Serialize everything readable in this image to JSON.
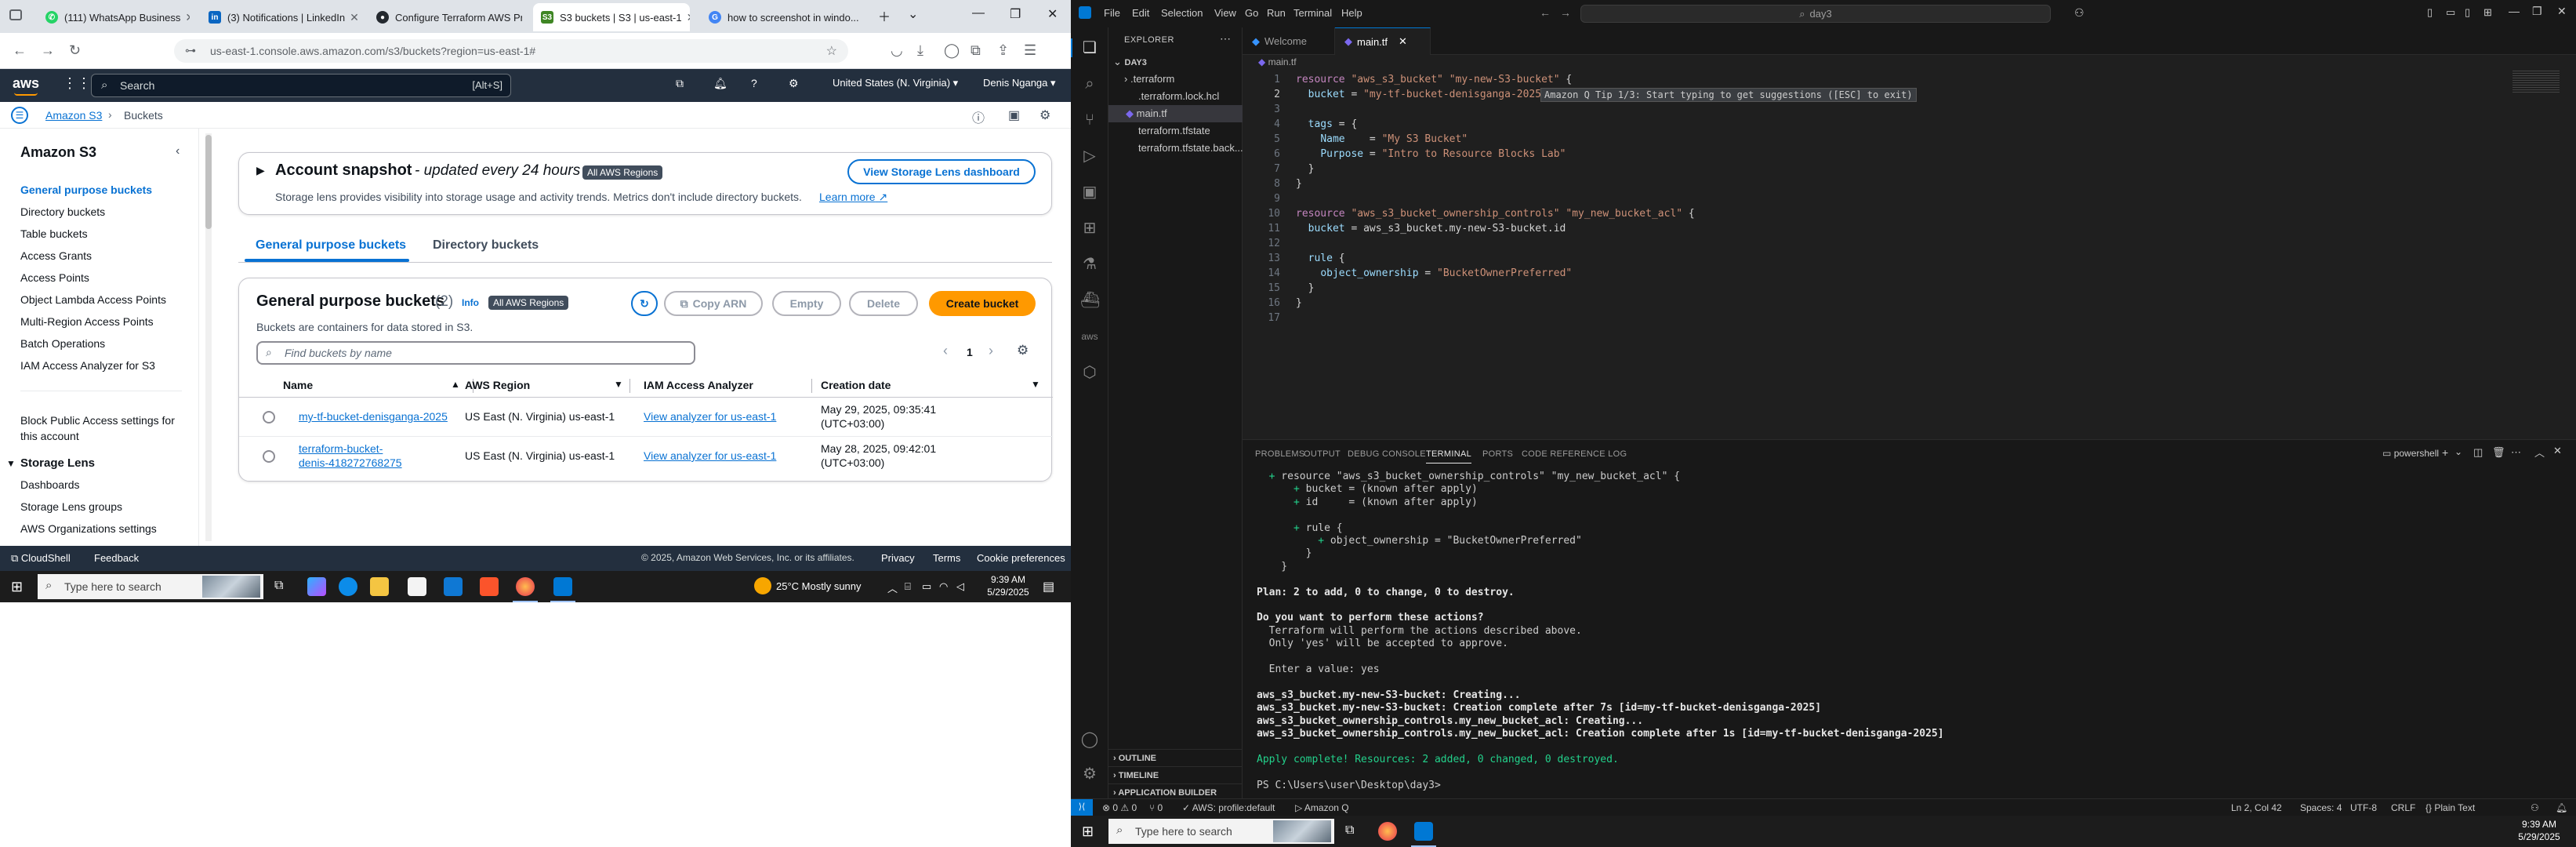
{
  "browser": {
    "tabs": [
      {
        "title": "(111) WhatsApp Business",
        "icon": "whatsapp-icon",
        "color": "#25d366"
      },
      {
        "title": "(3) Notifications | LinkedIn",
        "icon": "linkedin-icon",
        "color": "#0a66c2"
      },
      {
        "title": "Configure Terraform AWS Pr...",
        "icon": "github-icon",
        "color": "#24292f"
      },
      {
        "title": "S3 buckets | S3 | us-east-1",
        "icon": "aws-s3-icon",
        "color": "#3f8624"
      },
      {
        "title": "how to screenshot in windo...",
        "icon": "google-icon",
        "color": "#4285f4"
      }
    ],
    "url": "us-east-1.console.aws.amazon.com/s3/buckets?region=us-east-1#"
  },
  "aws": {
    "search_placeholder": "Search",
    "search_shortcut": "[Alt+S]",
    "region": "United States (N. Virginia)",
    "user": "Denis Nganga",
    "breadcrumb": [
      "Amazon S3",
      "Buckets"
    ],
    "sidenav": {
      "title": "Amazon S3",
      "items": [
        "General purpose buckets",
        "Directory buckets",
        "Table buckets",
        "Access Grants",
        "Access Points",
        "Object Lambda Access Points",
        "Multi-Region Access Points",
        "Batch Operations",
        "IAM Access Analyzer for S3"
      ],
      "block_public": "Block Public Access settings for this account",
      "storage_lens_title": "Storage Lens",
      "storage_lens_items": [
        "Dashboards",
        "Storage Lens groups",
        "AWS Organizations settings"
      ]
    },
    "snapshot": {
      "title": "Account snapshot",
      "subtitle": "- updated every 24 hours",
      "badge": "All AWS Regions",
      "desc": "Storage lens provides visibility into storage usage and activity trends. Metrics don't include directory buckets.",
      "learn_more": "Learn more",
      "button": "View Storage Lens dashboard"
    },
    "tabs": [
      "General purpose buckets",
      "Directory buckets"
    ],
    "buckets_panel": {
      "title": "General purpose buckets",
      "count": "(2)",
      "info": "Info",
      "badge": "All AWS Regions",
      "desc": "Buckets are containers for data stored in S3.",
      "copy_arn": "Copy ARN",
      "empty": "Empty",
      "delete": "Delete",
      "create": "Create bucket",
      "search_placeholder": "Find buckets by name",
      "page": "1",
      "columns": [
        "Name",
        "AWS Region",
        "IAM Access Analyzer",
        "Creation date"
      ],
      "rows": [
        {
          "name": "my-tf-bucket-denisganga-2025",
          "region": "US East (N. Virginia) us-east-1",
          "analyzer": "View analyzer for us-east-1",
          "date1": "May 29, 2025, 09:35:41",
          "date2": "(UTC+03:00)"
        },
        {
          "name1": "terraform-bucket-",
          "name2": "denis-418272768275",
          "region": "US East (N. Virginia) us-east-1",
          "analyzer": "View analyzer for us-east-1",
          "date1": "May 28, 2025, 09:42:01",
          "date2": "(UTC+03:00)"
        }
      ]
    },
    "footer": {
      "cloudshell": "CloudShell",
      "feedback": "Feedback",
      "copyright": "© 2025, Amazon Web Services, Inc. or its affiliates.",
      "privacy": "Privacy",
      "terms": "Terms",
      "cookies": "Cookie preferences"
    }
  },
  "taskbar_left": {
    "search": "Type here to search",
    "weather": "25°C  Mostly sunny",
    "time": "9:39 AM",
    "date": "5/29/2025"
  },
  "vscode": {
    "menus": [
      "File",
      "Edit",
      "Selection",
      "View",
      "Go",
      "Run",
      "Terminal",
      "Help"
    ],
    "command_center": "day3",
    "explorer_title": "EXPLORER",
    "folder": "DAY3",
    "files": [
      ".terraform",
      ".terraform.lock.hcl",
      "main.tf",
      "terraform.tfstate",
      "terraform.tfstate.back..."
    ],
    "outline": "OUTLINE",
    "timeline": "TIMELINE",
    "app_builder": "APPLICATION BUILDER",
    "editor_tabs": [
      "Welcome",
      "main.tf"
    ],
    "breadcrumb": "main.tf",
    "code": [
      "resource \"aws_s3_bucket\" \"my-new-S3-bucket\" {",
      "  bucket = \"my-tf-bucket-denisganga-2025\"",
      "",
      "  tags = {",
      "    Name    = \"My S3 Bucket\"",
      "    Purpose = \"Intro to Resource Blocks Lab\"",
      "  }",
      "}",
      "",
      "resource \"aws_s3_bucket_ownership_controls\" \"my_new_bucket_acl\" {",
      "  bucket = aws_s3_bucket.my-new-S3-bucket.id",
      "",
      "  rule {",
      "    object_ownership = \"BucketOwnerPreferred\"",
      "  }",
      "}",
      ""
    ],
    "hint": "Amazon Q Tip 1/3: Start typing to get suggestions ([ESC] to exit)",
    "panel_tabs": [
      "PROBLEMS",
      "OUTPUT",
      "DEBUG CONSOLE",
      "TERMINAL",
      "PORTS",
      "CODE REFERENCE LOG"
    ],
    "terminal_shell": "powershell",
    "terminal": [
      "  + resource \"aws_s3_bucket_ownership_controls\" \"my_new_bucket_acl\" {",
      "      + bucket = (known after apply)",
      "      + id     = (known after apply)",
      "",
      "      + rule {",
      "          + object_ownership = \"BucketOwnerPreferred\"",
      "        }",
      "    }",
      "",
      "Plan: 2 to add, 0 to change, 0 to destroy.",
      "",
      "Do you want to perform these actions?",
      "  Terraform will perform the actions described above.",
      "  Only 'yes' will be accepted to approve.",
      "",
      "  Enter a value: yes",
      "",
      "aws_s3_bucket.my-new-S3-bucket: Creating...",
      "aws_s3_bucket.my-new-S3-bucket: Creation complete after 7s [id=my-tf-bucket-denisganga-2025]",
      "aws_s3_bucket_ownership_controls.my_new_bucket_acl: Creating...",
      "aws_s3_bucket_ownership_controls.my_new_bucket_acl: Creation complete after 1s [id=my-tf-bucket-denisganga-2025]",
      "",
      "Apply complete! Resources: 2 added, 0 changed, 0 destroyed.",
      "",
      "PS C:\\Users\\user\\Desktop\\day3> "
    ],
    "status": {
      "errors": "⊗ 0 ⚠ 0",
      "ports": "⑂ 0",
      "profile": "AWS: profile:default",
      "amazonq": "Amazon Q",
      "position": "Ln 2, Col 42",
      "spaces": "Spaces: 4",
      "encoding": "UTF-8",
      "eol": "CRLF",
      "language": "Plain Text"
    }
  },
  "taskbar_right": {
    "search": "Type here to search",
    "time": "9:39 AM",
    "date": "5/29/2025"
  }
}
